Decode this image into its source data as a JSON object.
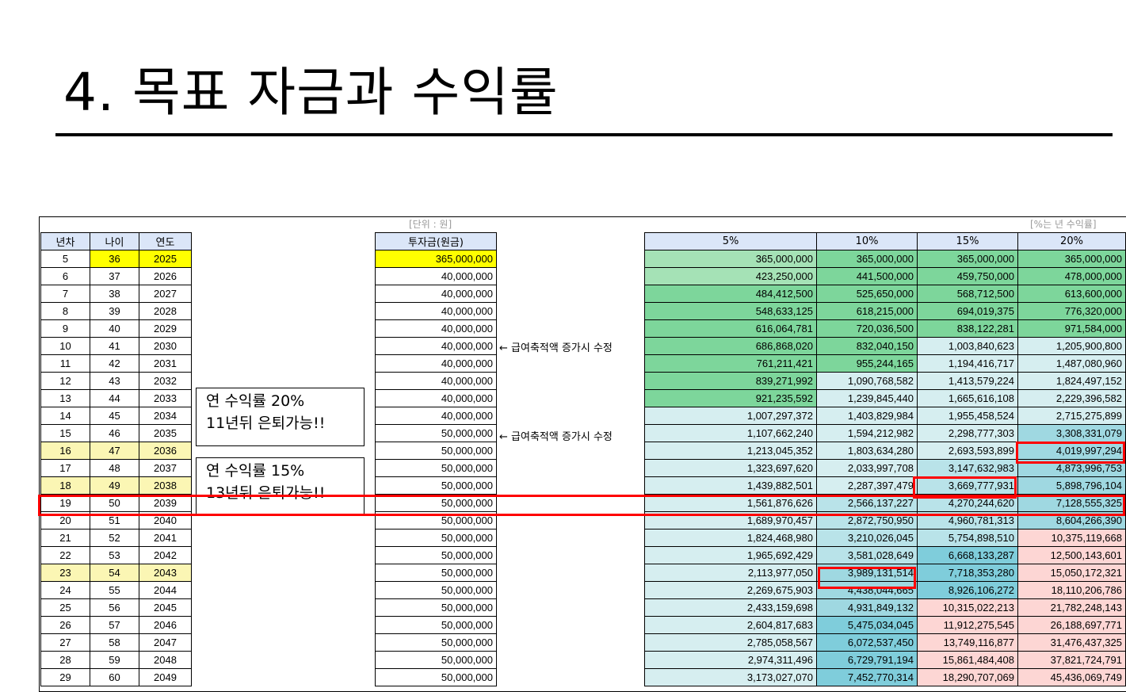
{
  "title": "4. 목표 자금과 수익률",
  "unit_note": "[단위 : 원]",
  "rate_note": "[%는 년 수익률]",
  "left_headers": [
    "년차",
    "나이",
    "연도"
  ],
  "invest_header": "투자금(원금)",
  "rate_headers": [
    "5%",
    "10%",
    "15%",
    "20%"
  ],
  "edit_note": "← 급여축적액 증가시 수정",
  "callouts": [
    {
      "line1": "연 수익률 20%",
      "line2": "11년뒤 은퇴가능!!"
    },
    {
      "line1": "연 수익률 15%",
      "line2": "13년뒤 은퇴가능!!"
    }
  ],
  "colors": {
    "dark_green": "#7dd69b",
    "light_green": "#a5e2b6",
    "pale_teal": "#d6eef0",
    "teal_light": "#b9e3e9",
    "teal": "#9fd8e1",
    "teal_deep": "#7fcddb",
    "pink": "#fdd6d4",
    "highlight_yellow": "#ffff00",
    "pale_yellow": "#fbf6b4",
    "red_box": "#ff0000",
    "header_blue": "#dbe6f8"
  },
  "rows": [
    {
      "n": "5",
      "age": "36",
      "year": "2025",
      "inv": "365,000,000",
      "r5": "365,000,000",
      "r10": "365,000,000",
      "r15": "365,000,000",
      "r20": "365,000,000"
    },
    {
      "n": "6",
      "age": "37",
      "year": "2026",
      "inv": "40,000,000",
      "r5": "423,250,000",
      "r10": "441,500,000",
      "r15": "459,750,000",
      "r20": "478,000,000"
    },
    {
      "n": "7",
      "age": "38",
      "year": "2027",
      "inv": "40,000,000",
      "r5": "484,412,500",
      "r10": "525,650,000",
      "r15": "568,712,500",
      "r20": "613,600,000"
    },
    {
      "n": "8",
      "age": "39",
      "year": "2028",
      "inv": "40,000,000",
      "r5": "548,633,125",
      "r10": "618,215,000",
      "r15": "694,019,375",
      "r20": "776,320,000"
    },
    {
      "n": "9",
      "age": "40",
      "year": "2029",
      "inv": "40,000,000",
      "r5": "616,064,781",
      "r10": "720,036,500",
      "r15": "838,122,281",
      "r20": "971,584,000"
    },
    {
      "n": "10",
      "age": "41",
      "year": "2030",
      "inv": "40,000,000",
      "r5": "686,868,020",
      "r10": "832,040,150",
      "r15": "1,003,840,623",
      "r20": "1,205,900,800"
    },
    {
      "n": "11",
      "age": "42",
      "year": "2031",
      "inv": "40,000,000",
      "r5": "761,211,421",
      "r10": "955,244,165",
      "r15": "1,194,416,717",
      "r20": "1,487,080,960"
    },
    {
      "n": "12",
      "age": "43",
      "year": "2032",
      "inv": "40,000,000",
      "r5": "839,271,992",
      "r10": "1,090,768,582",
      "r15": "1,413,579,224",
      "r20": "1,824,497,152"
    },
    {
      "n": "13",
      "age": "44",
      "year": "2033",
      "inv": "40,000,000",
      "r5": "921,235,592",
      "r10": "1,239,845,440",
      "r15": "1,665,616,108",
      "r20": "2,229,396,582"
    },
    {
      "n": "14",
      "age": "45",
      "year": "2034",
      "inv": "40,000,000",
      "r5": "1,007,297,372",
      "r10": "1,403,829,984",
      "r15": "1,955,458,524",
      "r20": "2,715,275,899"
    },
    {
      "n": "15",
      "age": "46",
      "year": "2035",
      "inv": "50,000,000",
      "r5": "1,107,662,240",
      "r10": "1,594,212,982",
      "r15": "2,298,777,303",
      "r20": "3,308,331,079"
    },
    {
      "n": "16",
      "age": "47",
      "year": "2036",
      "inv": "50,000,000",
      "r5": "1,213,045,352",
      "r10": "1,803,634,280",
      "r15": "2,693,593,899",
      "r20": "4,019,997,294"
    },
    {
      "n": "17",
      "age": "48",
      "year": "2037",
      "inv": "50,000,000",
      "r5": "1,323,697,620",
      "r10": "2,033,997,708",
      "r15": "3,147,632,983",
      "r20": "4,873,996,753"
    },
    {
      "n": "18",
      "age": "49",
      "year": "2038",
      "inv": "50,000,000",
      "r5": "1,439,882,501",
      "r10": "2,287,397,479",
      "r15": "3,669,777,931",
      "r20": "5,898,796,104"
    },
    {
      "n": "19",
      "age": "50",
      "year": "2039",
      "inv": "50,000,000",
      "r5": "1,561,876,626",
      "r10": "2,566,137,227",
      "r15": "4,270,244,620",
      "r20": "7,128,555,325"
    },
    {
      "n": "20",
      "age": "51",
      "year": "2040",
      "inv": "50,000,000",
      "r5": "1,689,970,457",
      "r10": "2,872,750,950",
      "r15": "4,960,781,313",
      "r20": "8,604,266,390"
    },
    {
      "n": "21",
      "age": "52",
      "year": "2041",
      "inv": "50,000,000",
      "r5": "1,824,468,980",
      "r10": "3,210,026,045",
      "r15": "5,754,898,510",
      "r20": "10,375,119,668"
    },
    {
      "n": "22",
      "age": "53",
      "year": "2042",
      "inv": "50,000,000",
      "r5": "1,965,692,429",
      "r10": "3,581,028,649",
      "r15": "6,668,133,287",
      "r20": "12,500,143,601"
    },
    {
      "n": "23",
      "age": "54",
      "year": "2043",
      "inv": "50,000,000",
      "r5": "2,113,977,050",
      "r10": "3,989,131,514",
      "r15": "7,718,353,280",
      "r20": "15,050,172,321"
    },
    {
      "n": "24",
      "age": "55",
      "year": "2044",
      "inv": "50,000,000",
      "r5": "2,269,675,903",
      "r10": "4,438,044,665",
      "r15": "8,926,106,272",
      "r20": "18,110,206,786"
    },
    {
      "n": "25",
      "age": "56",
      "year": "2045",
      "inv": "50,000,000",
      "r5": "2,433,159,698",
      "r10": "4,931,849,132",
      "r15": "10,315,022,213",
      "r20": "21,782,248,143"
    },
    {
      "n": "26",
      "age": "57",
      "year": "2046",
      "inv": "50,000,000",
      "r5": "2,604,817,683",
      "r10": "5,475,034,045",
      "r15": "11,912,275,545",
      "r20": "26,188,697,771"
    },
    {
      "n": "27",
      "age": "58",
      "year": "2047",
      "inv": "50,000,000",
      "r5": "2,785,058,567",
      "r10": "6,072,537,450",
      "r15": "13,749,116,877",
      "r20": "31,476,437,325"
    },
    {
      "n": "28",
      "age": "59",
      "year": "2048",
      "inv": "50,000,000",
      "r5": "2,974,311,496",
      "r10": "6,729,791,194",
      "r15": "15,861,484,408",
      "r20": "37,821,724,791"
    },
    {
      "n": "29",
      "age": "60",
      "year": "2049",
      "inv": "50,000,000",
      "r5": "3,173,027,070",
      "r10": "7,452,770,314",
      "r15": "18,290,707,069",
      "r20": "45,436,069,749"
    }
  ]
}
